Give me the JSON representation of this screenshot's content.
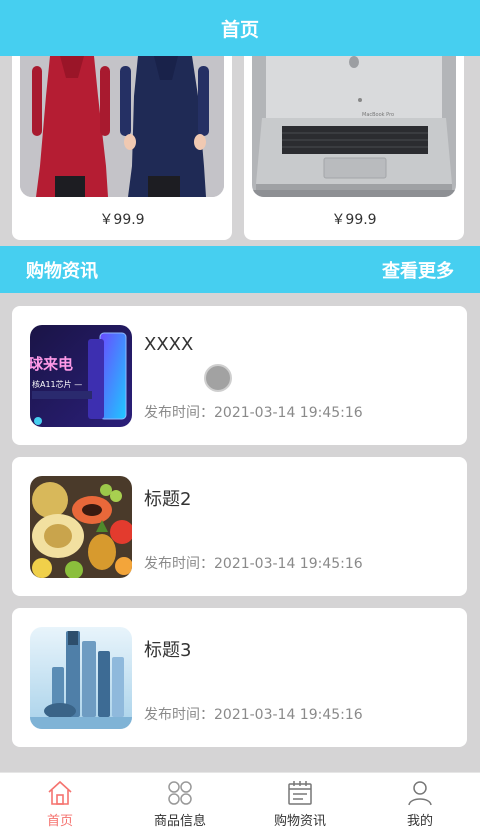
{
  "header": {
    "title": "首页"
  },
  "products": [
    {
      "price": "￥99.9",
      "image": "dresses-photo"
    },
    {
      "price": "￥99.9",
      "image": "laptop-photo"
    }
  ],
  "news_section": {
    "title": "购物资讯",
    "more_label": "查看更多"
  },
  "news": [
    {
      "title": "XXXX",
      "time_label": "发布时间：",
      "time": "2021-03-14 19:45:16",
      "thumb_text": "球来电",
      "thumb_sub": "核A11芯片 —"
    },
    {
      "title": "标题2",
      "time_label": "发布时间：",
      "time": "2021-03-14 19:45:16"
    },
    {
      "title": "标题3",
      "time_label": "发布时间：",
      "time": "2021-03-14 19:45:16"
    }
  ],
  "tabbar": [
    {
      "label": "首页",
      "icon": "home-icon",
      "active": true
    },
    {
      "label": "商品信息",
      "icon": "grid-icon",
      "active": false
    },
    {
      "label": "购物资讯",
      "icon": "calendar-icon",
      "active": false
    },
    {
      "label": "我的",
      "icon": "user-icon",
      "active": false
    }
  ],
  "colors": {
    "accent": "#46cff0",
    "active_tab": "#f5736f",
    "background": "#d5d4d5"
  }
}
